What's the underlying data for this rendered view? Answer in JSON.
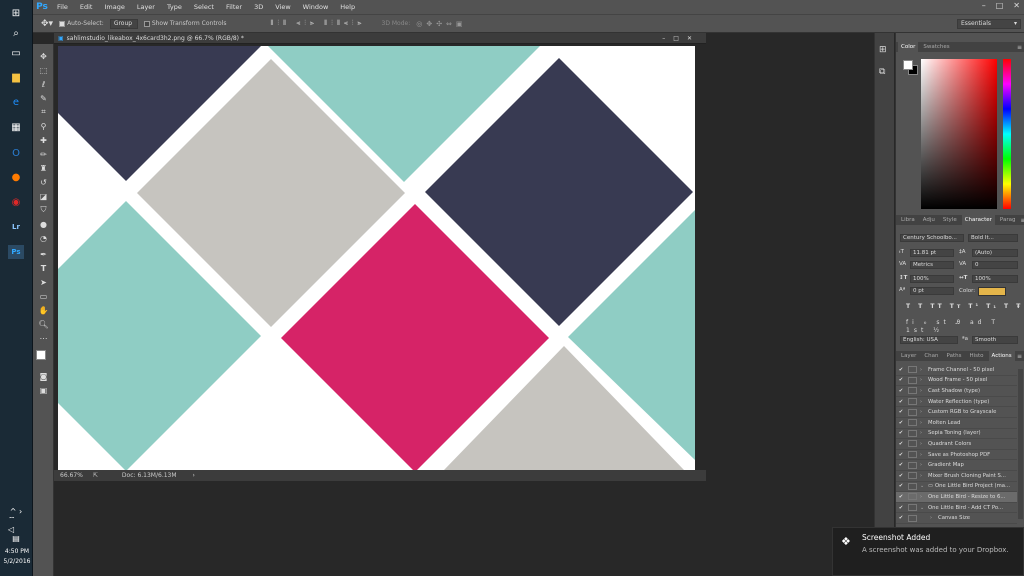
{
  "taskbar": {
    "time": "4:50 PM",
    "date": "5/2/2016"
  },
  "menu": {
    "logo": "Ps",
    "items": [
      "File",
      "Edit",
      "Image",
      "Layer",
      "Type",
      "Select",
      "Filter",
      "3D",
      "View",
      "Window",
      "Help"
    ]
  },
  "options": {
    "auto_select": "Auto-Select:",
    "group": "Group",
    "transform": "Show Transform Controls",
    "mode_3d": "3D Mode:",
    "workspace": "Essentials"
  },
  "document": {
    "tab_title": "sahlimstudio_likeabox_4x6card3h2.png @ 66.7% (RGB/8) *",
    "zoom": "66.67%",
    "doc_info": "Doc: 6.13M/6.13M"
  },
  "canvas_colors": {
    "navy": "#383a52",
    "gray": "#c6c4bf",
    "teal": "#8fcdc4",
    "pink": "#d62367"
  },
  "color_panel": {
    "tabs": [
      "Color",
      "Swatches"
    ]
  },
  "character_panel": {
    "tabs": [
      "Libra",
      "Adju",
      "Style",
      "Character",
      "Parag"
    ],
    "font": "Century Schoolbo...",
    "style": "Bold It...",
    "size": "11.81 pt",
    "leading": "(Auto)",
    "kerning": "Metrics",
    "tracking": "0",
    "vscale": "100%",
    "hscale": "100%",
    "baseline": "0 pt",
    "color_label": "Color:",
    "color": "#e4b54a",
    "language": "English: USA",
    "aa": "Smooth"
  },
  "actions_panel": {
    "tabs": [
      "Layer",
      "Chan",
      "Paths",
      "Histo",
      "Actions"
    ],
    "items": [
      "Frame Channel - 50 pixel",
      "Wood Frame - 50 pixel",
      "Cast Shadow (type)",
      "Water Reflection (type)",
      "Custom RGB to Grayscale",
      "Molten Lead",
      "Sepia Toning (layer)",
      "Quadrant Colors",
      "Save as Photoshop PDF",
      "Gradient Map",
      "Mixer Brush Cloning Paint S...",
      "One Little Bird Project (ma...",
      "One Little Bird - Resize to 6...",
      "One Little Bird - Add CT Po...",
      "Canvas Size"
    ]
  },
  "toast": {
    "title": "Screenshot Added",
    "body": "A screenshot was added to your Dropbox."
  }
}
